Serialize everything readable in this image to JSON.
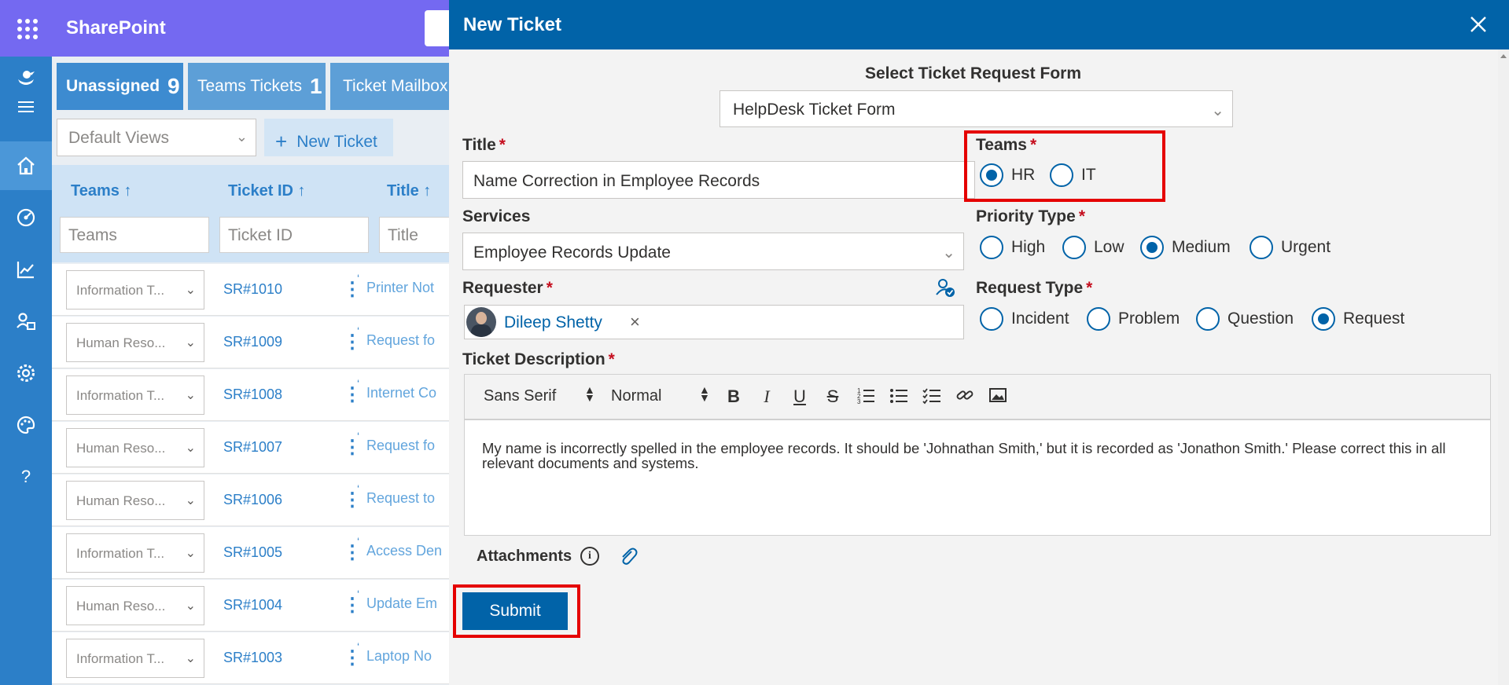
{
  "app": {
    "name": "SharePoint"
  },
  "rail": {
    "icons": [
      "app-logo-icon",
      "menu-icon",
      "home-icon",
      "dashboard-icon",
      "analytics-icon",
      "agent-icon",
      "settings-icon",
      "palette-icon",
      "help-icon"
    ]
  },
  "tabs": [
    {
      "label": "Unassigned",
      "count": "9"
    },
    {
      "label": "Teams Tickets",
      "count": "1"
    },
    {
      "label": "Ticket Mailbox",
      "count": ""
    }
  ],
  "toolbar": {
    "views_value": "Default Views",
    "new_ticket_label": "New Ticket"
  },
  "grid": {
    "columns": [
      "Teams ↑",
      "Ticket ID ↑",
      "Title ↑"
    ],
    "filters": {
      "teams": "Teams",
      "ticket_id": "Ticket ID",
      "title": "Title"
    },
    "rows": [
      {
        "team": "Information T...",
        "id": "SR#1010",
        "title": "Printer Not"
      },
      {
        "team": "Human Reso...",
        "id": "SR#1009",
        "title": "Request fo"
      },
      {
        "team": "Information T...",
        "id": "SR#1008",
        "title": "Internet Co"
      },
      {
        "team": "Human Reso...",
        "id": "SR#1007",
        "title": "Request fo"
      },
      {
        "team": "Human Reso...",
        "id": "SR#1006",
        "title": "Request to"
      },
      {
        "team": "Information T...",
        "id": "SR#1005",
        "title": "Access Den"
      },
      {
        "team": "Human Reso...",
        "id": "SR#1004",
        "title": "Update Em"
      },
      {
        "team": "Information T...",
        "id": "SR#1003",
        "title": "Laptop No"
      }
    ]
  },
  "panel": {
    "title": "New Ticket",
    "form_select_label": "Select Ticket Request Form",
    "form_select_value": "HelpDesk Ticket Form",
    "title_label": "Title",
    "title_value": "Name Correction in Employee Records",
    "teams_label": "Teams",
    "teams_options": [
      "HR",
      "IT"
    ],
    "teams_selected": "HR",
    "services_label": "Services",
    "services_value": "Employee Records Update",
    "priority_label": "Priority Type",
    "priority_options": [
      "High",
      "Low",
      "Medium",
      "Urgent"
    ],
    "priority_selected": "Medium",
    "requester_label": "Requester",
    "requester_name": "Dileep Shetty",
    "request_type_label": "Request Type",
    "request_type_options": [
      "Incident",
      "Problem",
      "Question",
      "Request"
    ],
    "request_type_selected": "Request",
    "description_label": "Ticket Description",
    "editor_font": "Sans Serif",
    "editor_size": "Normal",
    "description_text": "My name is incorrectly spelled in the employee records. It should be 'Johnathan Smith,' but it is recorded as 'Jonathon Smith.' Please correct this in all relevant documents and systems.",
    "attachments_label": "Attachments",
    "submit_label": "Submit",
    "required_mark": "*"
  },
  "colors": {
    "accent": "#0163a8",
    "topbar": "#7469f1",
    "rail": "#2c7fc8",
    "highlight": "#e50000"
  }
}
